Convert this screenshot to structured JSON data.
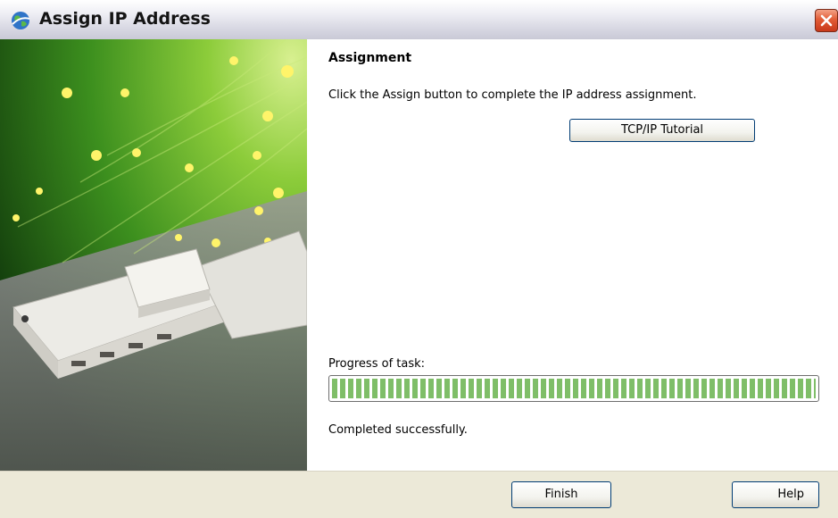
{
  "window": {
    "title": "Assign IP Address"
  },
  "icons": {
    "title": "globe-network-icon",
    "close": "close-icon"
  },
  "banner": {
    "description_icon": "fiber-optic-device-servers-image"
  },
  "content": {
    "heading": "Assignment",
    "instruction": "Click the Assign button to complete the IP address assignment.",
    "tutorial_button": "TCP/IP Tutorial",
    "progress_label": "Progress of task:",
    "progress_percent": 100,
    "status": "Completed successfully."
  },
  "buttons": {
    "finish": "Finish",
    "help": "Help"
  },
  "colors": {
    "progress_green": "#7fbe68",
    "close_red": "#e25c36",
    "button_border": "#003c74"
  }
}
